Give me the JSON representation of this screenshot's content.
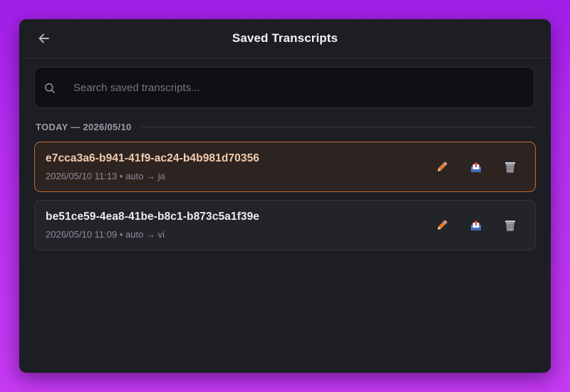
{
  "header": {
    "title": "Saved Transcripts",
    "back_icon": "arrow-left-icon"
  },
  "search": {
    "placeholder": "Search saved transcripts...",
    "value": "",
    "icon": "search-icon"
  },
  "section": {
    "label": "TODAY — 2026/05/10"
  },
  "transcripts": [
    {
      "id": "e7cca3a6-b941-41f9-ac24-b4b981d70356",
      "datetime": "2026/05/10 11:13",
      "source_lang": "auto",
      "target_lang": "ja",
      "selected": true
    },
    {
      "id": "be51ce59-4ea8-41be-b8c1-b873c5a1f39e",
      "datetime": "2026/05/10 11:09",
      "source_lang": "auto",
      "target_lang": "vi",
      "selected": false
    }
  ],
  "meta_separators": {
    "dot": "•",
    "arrow": "→"
  },
  "actions": [
    "pencil-icon",
    "export-tray-icon",
    "trash-can-icon"
  ],
  "colors": {
    "background_gradient": [
      "#a01fe8",
      "#c63af2"
    ],
    "panel": "#1d1d24",
    "selected_border": "#c16a33",
    "selected_title": "#f4ccb0"
  }
}
